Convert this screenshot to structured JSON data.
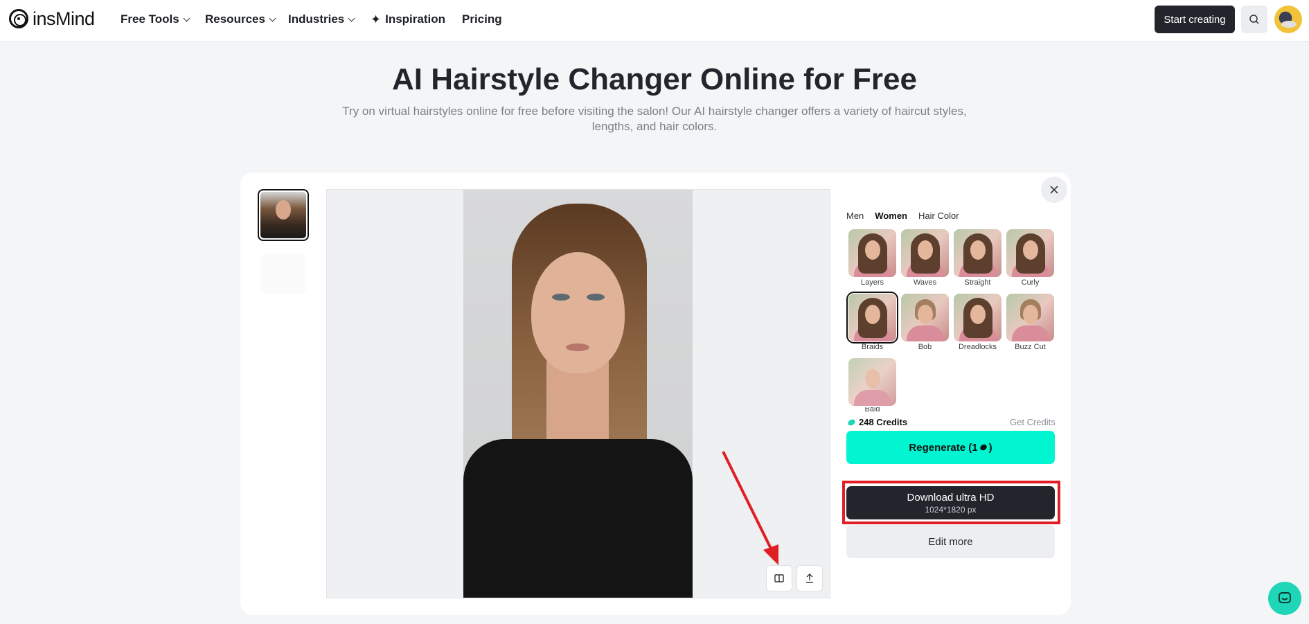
{
  "brand": {
    "name": "insMind"
  },
  "nav": {
    "items": [
      {
        "label": "Free Tools",
        "dropdown": true
      },
      {
        "label": "Resources",
        "dropdown": true
      },
      {
        "label": "Industries",
        "dropdown": true
      },
      {
        "label": "Inspiration",
        "icon": "sparkle-icon"
      },
      {
        "label": "Pricing"
      }
    ],
    "start_label": "Start creating"
  },
  "hero": {
    "title": "AI Hairstyle Changer Online for Free",
    "subtitle": "Try on virtual hairstyles online for free before visiting the salon! Our AI hairstyle changer offers a variety of haircut styles, lengths, and hair colors."
  },
  "panel": {
    "tabs": [
      {
        "label": "Men",
        "active": false
      },
      {
        "label": "Women",
        "active": true
      },
      {
        "label": "Hair Color",
        "active": false
      }
    ],
    "styles": [
      {
        "label": "Layers",
        "selected": false
      },
      {
        "label": "Waves",
        "selected": false
      },
      {
        "label": "Straight",
        "selected": false
      },
      {
        "label": "Curly",
        "selected": false
      },
      {
        "label": "Braids",
        "selected": true
      },
      {
        "label": "Bob",
        "selected": false
      },
      {
        "label": "Dreadlocks",
        "selected": false
      },
      {
        "label": "Buzz Cut",
        "selected": false
      },
      {
        "label": "Bald",
        "selected": false
      }
    ],
    "credits": "248 Credits",
    "get_credits": "Get Credits",
    "regenerate_label": "Regenerate (1",
    "regenerate_suffix": ")",
    "download_label": "Download ultra HD",
    "download_size": "1024*1820 px",
    "edit_label": "Edit more"
  },
  "colors": {
    "accent": "#00f5d0",
    "dark": "#22262c",
    "highlight": "#e01f24"
  }
}
